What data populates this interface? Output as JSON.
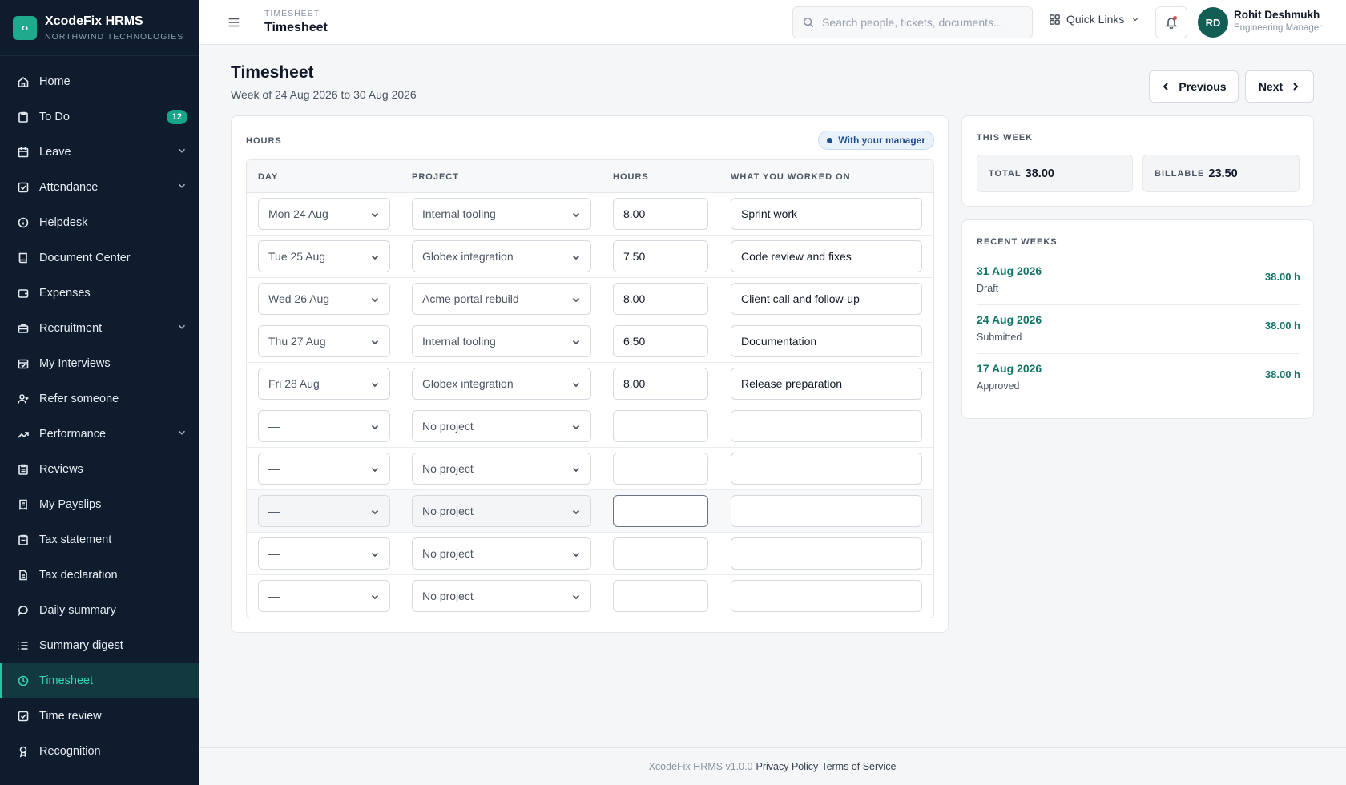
{
  "brand": {
    "name": "XcodeFix HRMS",
    "org": "NORTHWIND TECHNOLOGIES",
    "logo_glyph": "‹›"
  },
  "sidebar": {
    "items": [
      {
        "label": "Home",
        "icon": "home-icon"
      },
      {
        "label": "To Do",
        "icon": "clipboard-icon",
        "badge": "12"
      },
      {
        "label": "Leave",
        "icon": "calendar-icon",
        "expandable": true
      },
      {
        "label": "Attendance",
        "icon": "check-square-icon",
        "expandable": true
      },
      {
        "label": "Helpdesk",
        "icon": "info-icon"
      },
      {
        "label": "Document Center",
        "icon": "book-icon"
      },
      {
        "label": "Expenses",
        "icon": "wallet-icon"
      },
      {
        "label": "Recruitment",
        "icon": "briefcase-icon",
        "expandable": true
      },
      {
        "label": "My Interviews",
        "icon": "calendar-check-icon"
      },
      {
        "label": "Refer someone",
        "icon": "user-plus-icon"
      },
      {
        "label": "Performance",
        "icon": "trend-icon",
        "expandable": true
      },
      {
        "label": "Reviews",
        "icon": "clipboard-list-icon"
      },
      {
        "label": "My Payslips",
        "icon": "receipt-icon"
      },
      {
        "label": "Tax statement",
        "icon": "clipboard-doc-icon"
      },
      {
        "label": "Tax declaration",
        "icon": "file-icon"
      },
      {
        "label": "Daily summary",
        "icon": "chat-icon"
      },
      {
        "label": "Summary digest",
        "icon": "list-icon"
      },
      {
        "label": "Timesheet",
        "icon": "clock-icon",
        "active": true
      },
      {
        "label": "Time review",
        "icon": "check-square-icon"
      },
      {
        "label": "Recognition",
        "icon": "award-icon"
      }
    ]
  },
  "header": {
    "crumb": "TIMESHEET",
    "title": "Timesheet",
    "search_placeholder": "Search people, tickets, documents...",
    "quick_links": "Quick Links",
    "user_initials": "RD",
    "user_name": "Rohit Deshmukh",
    "user_role": "Engineering Manager"
  },
  "page": {
    "title": "Timesheet",
    "subtitle": "Week of 24 Aug 2026 to 30 Aug 2026",
    "prev_label": "Previous",
    "next_label": "Next"
  },
  "hours": {
    "label": "HOURS",
    "status": "With your manager",
    "columns": [
      "DAY",
      "PROJECT",
      "HOURS",
      "WHAT YOU WORKED ON"
    ],
    "rows": [
      {
        "day": "Mon 24 Aug",
        "project": "Internal tooling",
        "hours": "8.00",
        "note": "Sprint work"
      },
      {
        "day": "Tue 25 Aug",
        "project": "Globex integration",
        "hours": "7.50",
        "note": "Code review and fixes"
      },
      {
        "day": "Wed 26 Aug",
        "project": "Acme portal rebuild",
        "hours": "8.00",
        "note": "Client call and follow-up"
      },
      {
        "day": "Thu 27 Aug",
        "project": "Internal tooling",
        "hours": "6.50",
        "note": "Documentation"
      },
      {
        "day": "Fri 28 Aug",
        "project": "Globex integration",
        "hours": "8.00",
        "note": "Release preparation"
      },
      {
        "day": "—",
        "project": "No project",
        "hours": "",
        "note": ""
      },
      {
        "day": "—",
        "project": "No project",
        "hours": "",
        "note": ""
      },
      {
        "day": "—",
        "project": "No project",
        "hours": "",
        "note": "",
        "highlighted": true
      },
      {
        "day": "—",
        "project": "No project",
        "hours": "",
        "note": ""
      },
      {
        "day": "—",
        "project": "No project",
        "hours": "",
        "note": ""
      }
    ]
  },
  "this_week": {
    "label": "THIS WEEK",
    "total_label": "TOTAL",
    "total": "38.00",
    "billable_label": "BILLABLE",
    "billable": "23.50"
  },
  "recent": {
    "label": "RECENT WEEKS",
    "weeks": [
      {
        "date": "31 Aug 2026",
        "status": "Draft",
        "hours": "38.00 h"
      },
      {
        "date": "24 Aug 2026",
        "status": "Submitted",
        "hours": "38.00 h"
      },
      {
        "date": "17 Aug 2026",
        "status": "Approved",
        "hours": "38.00 h"
      }
    ]
  },
  "footer": {
    "version": "XcodeFix HRMS v1.0.0",
    "privacy": "Privacy Policy",
    "terms": "Terms of Service"
  },
  "colors": {
    "sidebar_bg": "#0f1c2e",
    "accent": "#1fa98d",
    "link": "#127567"
  }
}
